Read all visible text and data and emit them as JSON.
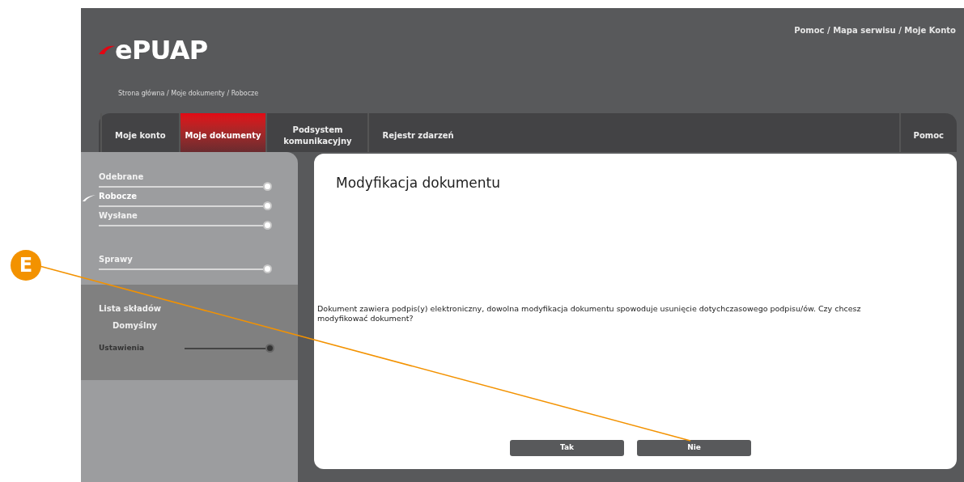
{
  "header": {
    "logo": "ePUAP",
    "top_links": "Pomoc / Mapa serwisu / Moje Konto",
    "breadcrumb": "Strona główna / Moje dokumenty / Robocze"
  },
  "tabs": [
    {
      "label": "Moje konto",
      "selected": false
    },
    {
      "label": "Moje dokumenty",
      "selected": true
    },
    {
      "label": "Podsystem komunikacyjny",
      "selected": false
    },
    {
      "label": "Rejestr zdarzeń",
      "selected": false
    }
  ],
  "right_tabs": [
    {
      "label": "Pomoc",
      "selected": false
    }
  ],
  "sidebar": {
    "folders": [
      {
        "label": "Odebrane",
        "selected": false
      },
      {
        "label": "Robocze",
        "selected": true
      },
      {
        "label": "Wysłane",
        "selected": false
      }
    ],
    "cases": [
      {
        "label": "Sprawy",
        "selected": false
      }
    ],
    "lists_title": "Lista składów",
    "lists": [
      "Domyślny"
    ],
    "settings": "Ustawienia"
  },
  "dialog": {
    "title": "Modyfikacja dokumentu",
    "message": "Dokument zawiera podpis(y) elektroniczny, dowolna modyfikacja dokumentu spowoduje usunięcie dotychczasowego podpisu/ów. Czy chcesz modyfikować dokument?",
    "buttons": [
      "Tak",
      "Nie"
    ]
  },
  "callout": {
    "label": "E"
  }
}
